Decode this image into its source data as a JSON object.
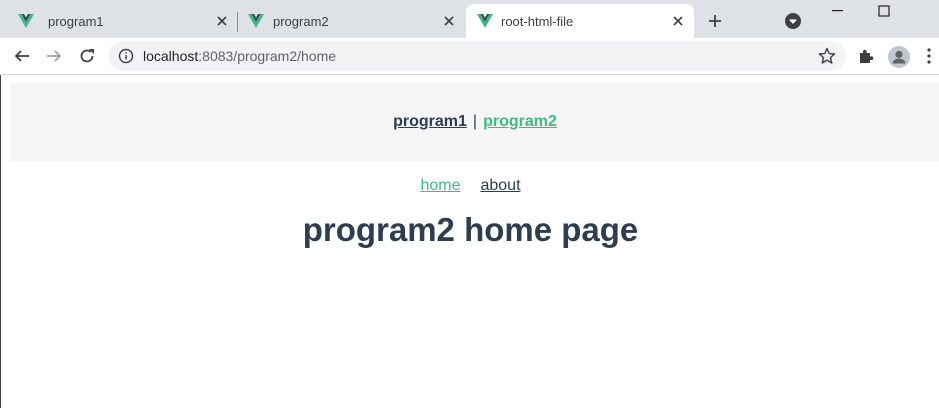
{
  "browser": {
    "tabs": [
      {
        "title": "program1",
        "active": false
      },
      {
        "title": "program2",
        "active": false
      },
      {
        "title": "root-html-file",
        "active": true
      }
    ],
    "url": {
      "host": "localhost",
      "rest": ":8083/program2/home"
    }
  },
  "app": {
    "root_nav": {
      "link1": "program1",
      "separator": "|",
      "link2": "program2"
    },
    "sub_nav": {
      "home": "home",
      "about": "about"
    },
    "heading": "program2 home page"
  },
  "colors": {
    "vue_green": "#42b983",
    "vue_dark": "#35495e",
    "text_dark": "#2c3e50",
    "nav_bg": "#f5f5f5",
    "tabbar_bg": "#dee1e6"
  },
  "icons": {
    "favicon": "vue-logo-icon",
    "close": "close-icon",
    "new_tab": "plus-icon",
    "tab_search": "tab-search-icon",
    "minimize": "minimize-icon",
    "maximize": "maximize-icon",
    "back": "back-arrow-icon",
    "forward": "forward-arrow-icon",
    "reload": "reload-icon",
    "info": "info-icon",
    "bookmark": "star-icon",
    "extensions": "puzzle-icon",
    "profile": "avatar-icon",
    "menu": "more-vertical-icon"
  }
}
